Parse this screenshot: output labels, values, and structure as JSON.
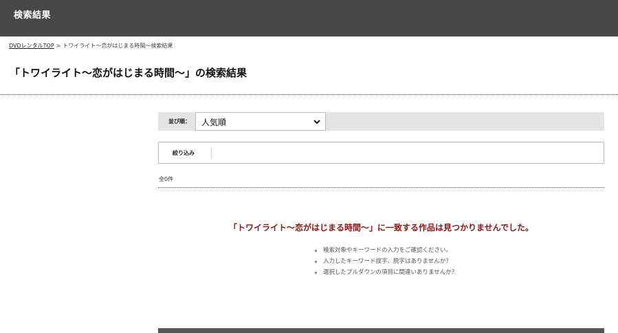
{
  "header": {
    "title": "検索結果"
  },
  "breadcrumb": {
    "home_label": "DVDレンタルTOP",
    "separator": ">",
    "current": "トワイライト～恋がはじまる時間～検索結果"
  },
  "page": {
    "title": "「トワイライト～恋がはじまる時間～」の検索結果"
  },
  "sort": {
    "label": "並び順：",
    "selected": "人気順"
  },
  "filter": {
    "label": "絞り込み"
  },
  "results": {
    "count_text": "全0件",
    "no_result_message": "「トワイライト～恋がはじまる時間～」に一致する作品は見つかりませんでした。",
    "tips": [
      "検索対象やキーワードの入力をご確認ください。",
      "入力したキーワード誤字、脱字はありませんか？",
      "選択したプルダウンの項目に間違いありませんか？"
    ]
  },
  "icons": {
    "sort_dropdown": "chevron-down-icon"
  },
  "colors": {
    "header_bg": "#474747",
    "sort_bar_bg": "#e4e4e4",
    "alert_text": "#8b1515",
    "bottom_bar_bg": "#555555"
  }
}
